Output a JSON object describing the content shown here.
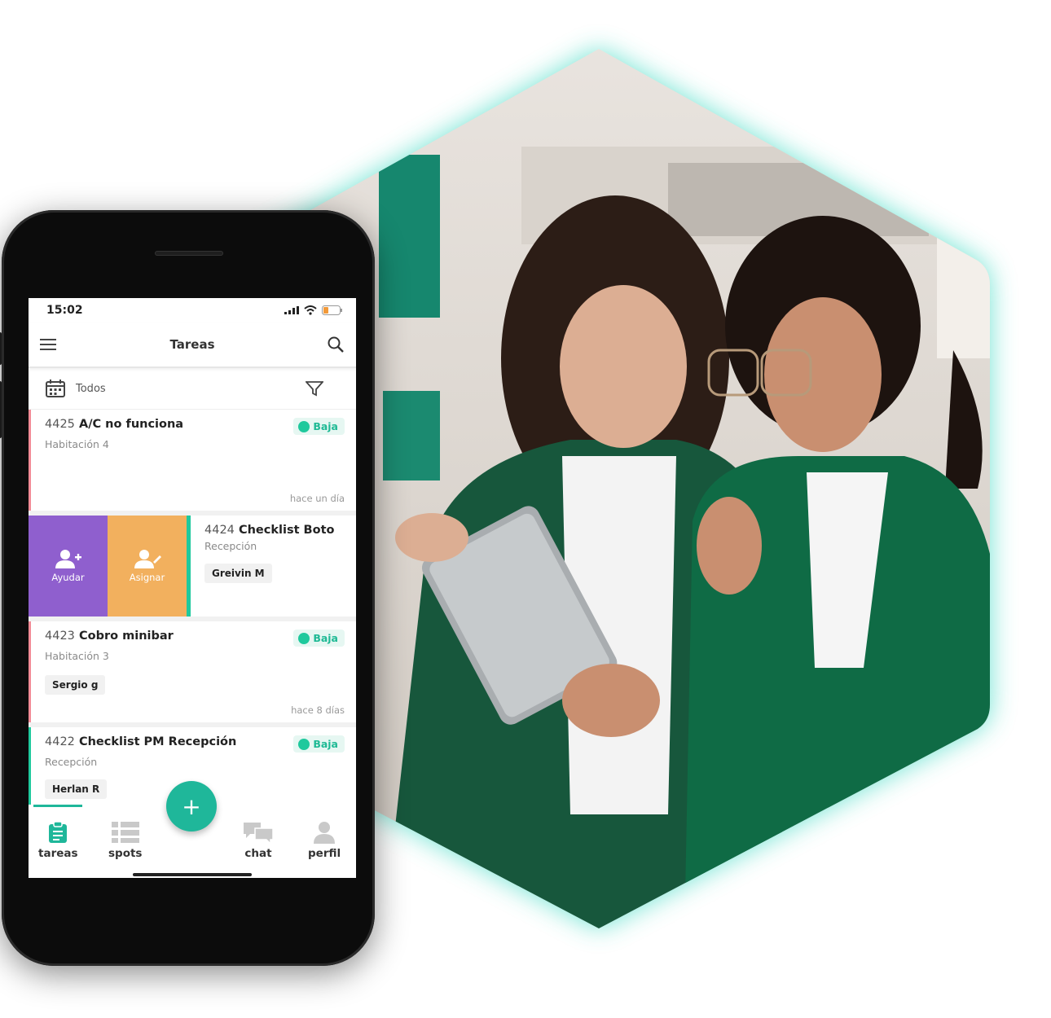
{
  "phone": {
    "status_time": "15:02",
    "app_title": "Tareas",
    "filter_label": "Todos",
    "tasks": [
      {
        "number": "4425",
        "title": "A/C no funciona",
        "location": "Habitación 4",
        "priority": "Baja",
        "assignee": "",
        "time": "hace un día",
        "accent": "#f28b96"
      },
      {
        "number": "4424",
        "title": "Checklist Boto",
        "location": "Recepción",
        "priority": "",
        "assignee": "Greivin M",
        "time": "",
        "accent": "#1fc99d"
      },
      {
        "number": "4423",
        "title": "Cobro minibar",
        "location": "Habitación 3",
        "priority": "Baja",
        "assignee": "Sergio g",
        "time": "hace 8 días",
        "accent": "#f28b96"
      },
      {
        "number": "4422",
        "title": "Checklist PM Recepción",
        "location": "Recepción",
        "priority": "Baja",
        "assignee": "Herlan R",
        "time": "",
        "accent": "#1fc99d"
      }
    ],
    "swipe_actions": [
      {
        "label": "Ayudar",
        "color": "#8f5fce",
        "icon": "add-user-icon"
      },
      {
        "label": "Asignar",
        "color": "#f2b05e",
        "icon": "assign-user-icon"
      }
    ],
    "fab_label": "+",
    "tabs": [
      {
        "label": "tareas",
        "icon": "clipboard-icon",
        "active": true
      },
      {
        "label": "spots",
        "icon": "list-icon",
        "active": false
      },
      {
        "label": "chat",
        "icon": "chat-icon",
        "active": false
      },
      {
        "label": "perfil",
        "icon": "user-icon",
        "active": false
      }
    ]
  },
  "colors": {
    "accent": "#1fb79a",
    "hex_glow": "#5fe0cd",
    "priority_low": "#1fc99d"
  }
}
